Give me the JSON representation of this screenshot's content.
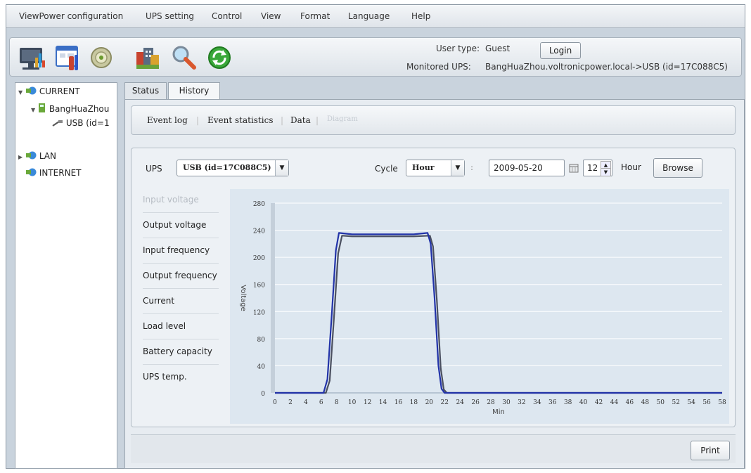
{
  "menu": [
    "ViewPower configuration",
    "UPS setting",
    "Control",
    "View",
    "Format",
    "Language",
    "Help"
  ],
  "toolbar": {
    "icons": [
      "monitor-chart-icon",
      "settings-tools-icon",
      "power-disc-icon",
      "building-icon",
      "magnifier-icon",
      "refresh-icon"
    ],
    "user_type_label": "User type:",
    "user_type_value": "Guest",
    "login_label": "Login",
    "monitored_label": "Monitored UPS:",
    "monitored_value": "BangHuaZhou.voltronicpower.local->USB (id=17C088C5)"
  },
  "tree": {
    "current": "CURRENT",
    "host": "BangHuaZhou",
    "usb": "USB (id=1",
    "lan": "LAN",
    "internet": "INTERNET"
  },
  "tabs": [
    "Status",
    "History"
  ],
  "subnav": [
    "Event log",
    "Event statistics",
    "Data",
    "Diagram"
  ],
  "form": {
    "ups_label": "UPS",
    "ups_value": "USB (id=17C088C5)",
    "cycle_label": "Cycle",
    "cycle_value": "Hour",
    "colon": ":",
    "date_value": "2009-05-20",
    "hour_value": "12",
    "hour_label": "Hour",
    "browse_label": "Browse"
  },
  "params": [
    "Input voltage",
    "Output voltage",
    "Input frequency",
    "Output frequency",
    "Current",
    "Load level",
    "Battery capacity",
    "UPS temp."
  ],
  "print_label": "Print",
  "chart_data": {
    "type": "line",
    "xlabel": "Min",
    "ylabel": "Voltage",
    "xlim": [
      0,
      58
    ],
    "ylim": [
      0,
      280
    ],
    "xticks": [
      0,
      2,
      4,
      6,
      8,
      10,
      12,
      14,
      16,
      18,
      20,
      22,
      24,
      26,
      28,
      30,
      32,
      34,
      36,
      38,
      40,
      42,
      44,
      46,
      48,
      50,
      52,
      54,
      56,
      58
    ],
    "yticks": [
      0,
      40,
      80,
      120,
      160,
      200,
      240,
      280
    ],
    "grid": true,
    "series": [
      {
        "color": "#2233a8",
        "x": [
          0,
          6.3,
          6.8,
          7.4,
          7.9,
          8.3,
          10,
          14,
          18,
          19.8,
          20.2,
          20.7,
          21.2,
          21.6,
          22,
          58
        ],
        "y": [
          0,
          0,
          20,
          120,
          210,
          236,
          234,
          234,
          234,
          236,
          220,
          140,
          40,
          6,
          0,
          0
        ]
      },
      {
        "color": "#4b5060",
        "x": [
          0,
          6.6,
          7.1,
          7.7,
          8.2,
          8.7,
          10,
          14,
          18,
          20.1,
          20.5,
          21.0,
          21.5,
          21.9,
          22.3,
          58
        ],
        "y": [
          0,
          0,
          18,
          118,
          206,
          232,
          231,
          231,
          231,
          232,
          216,
          136,
          36,
          5,
          0,
          0
        ]
      }
    ]
  }
}
